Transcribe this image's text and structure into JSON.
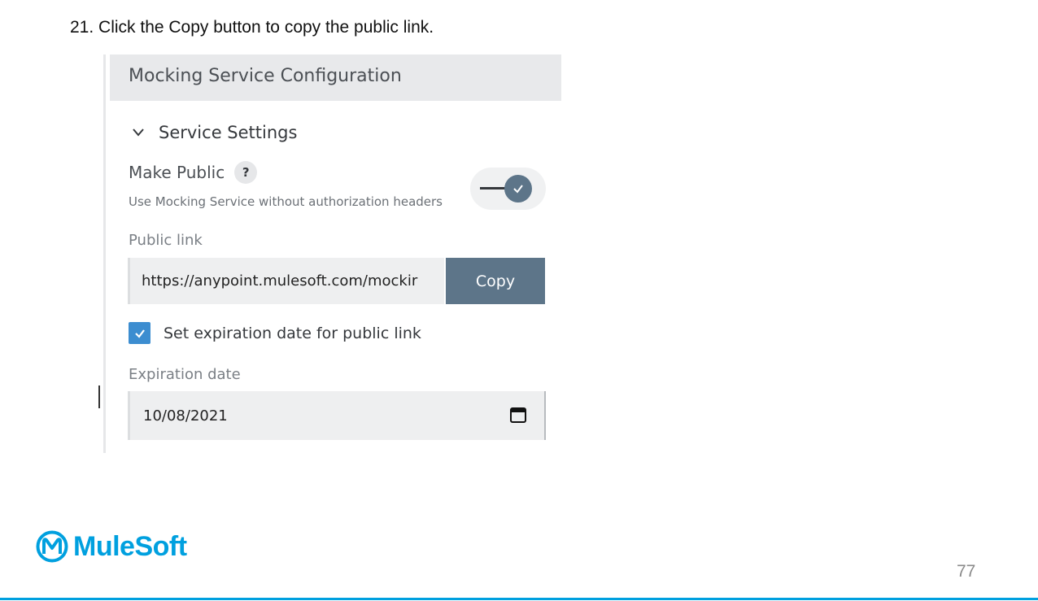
{
  "step": {
    "text": "21. Click the Copy button to copy the public link."
  },
  "panel": {
    "title": "Mocking Service Configuration",
    "section_title": "Service Settings",
    "make_public": {
      "label": "Make Public",
      "help": "?",
      "description": "Use Mocking Service without authorization headers",
      "enabled": true
    },
    "public_link": {
      "label": "Public link",
      "value": "https://anypoint.mulesoft.com/mockir",
      "copy_label": "Copy"
    },
    "expiration": {
      "checkbox_label": "Set expiration date for public link",
      "checked": true,
      "date_label": "Expiration date",
      "date_value": "10/08/2021"
    }
  },
  "footer": {
    "brand": "MuleSoft",
    "page_number": "77"
  },
  "colors": {
    "accent": "#00a0df",
    "button": "#5d7589",
    "checkbox": "#3c8dd0"
  }
}
